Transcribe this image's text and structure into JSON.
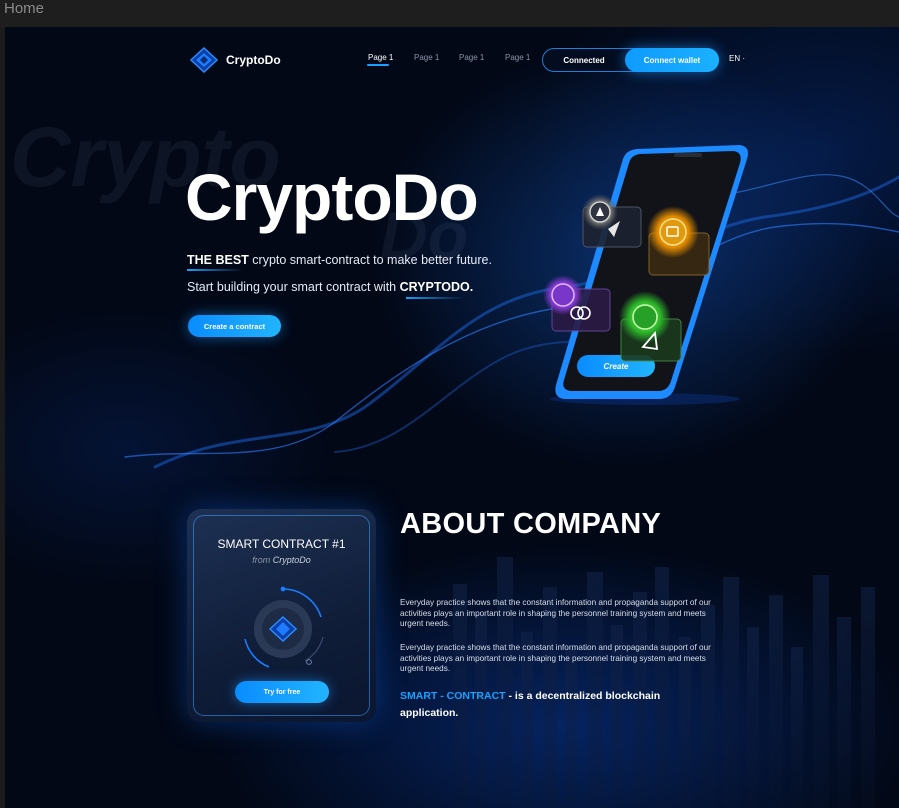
{
  "window": {
    "title": "Home"
  },
  "nav": {
    "logo_text": "CryptoDo",
    "items": [
      {
        "label": "Page 1"
      },
      {
        "label": "Page 1"
      },
      {
        "label": "Page 1"
      },
      {
        "label": "Page 1"
      }
    ],
    "connected_label": "Connected",
    "connect_wallet_label": "Connect wallet",
    "language": "EN",
    "language_caret": "·"
  },
  "hero": {
    "title": "CryptoDo",
    "ghost_left": "Crypto",
    "ghost_right": "Do",
    "line1_bold": "THE BEST",
    "line1_rest": " crypto smart-contract to make better future.",
    "line2_rest": "Start building your smart contract with ",
    "line2_bold": "CRYPTODO.",
    "create_button": "Create a contract",
    "phone_button": "Create"
  },
  "about": {
    "title": "ABOUT COMPANY",
    "card_title": "SMART CONTRACT #1",
    "card_from": "from",
    "card_brand": "CryptoDo",
    "try_button": "Try for free",
    "paragraphs": [
      "Everyday practice shows that the constant information and propaganda support of our activities plays an important role in shaping the personnel training system and meets urgent needs.",
      "Everyday practice shows that the constant information and propaganda support of our activities plays an important role in shaping the personnel training system and meets urgent needs."
    ],
    "tag_highlight": "SMART - CONTRACT",
    "tag_rest": " - is a decentralized blockchain application."
  },
  "colors": {
    "accent": "#1aa0ff",
    "background": "#020816",
    "card": "#1e3154"
  }
}
